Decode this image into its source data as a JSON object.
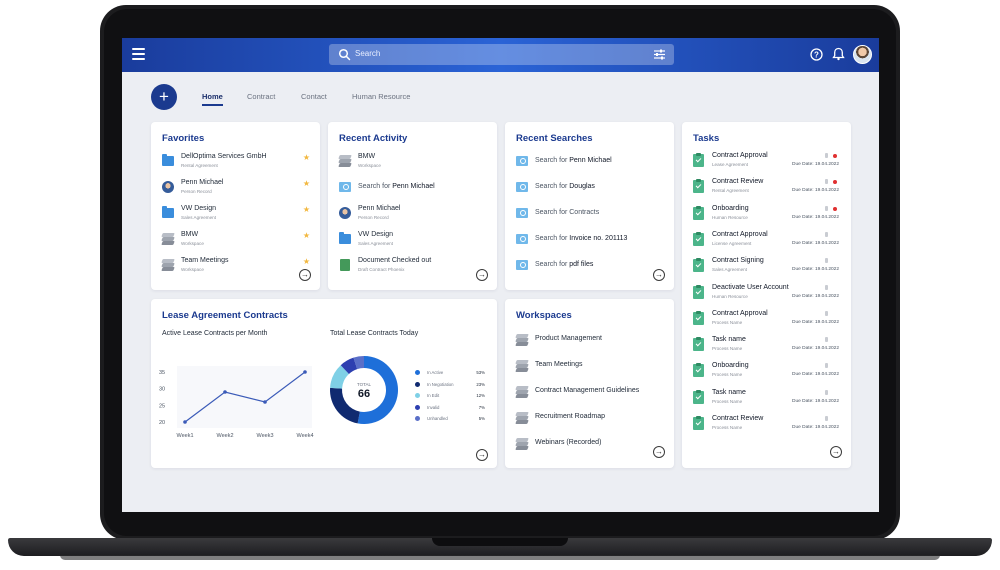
{
  "header": {
    "search_placeholder": "Search",
    "icons": [
      "menu-icon",
      "search-icon",
      "filter-icon",
      "help-icon",
      "bell-icon"
    ]
  },
  "nav": {
    "fab_label": "+",
    "tabs": [
      {
        "label": "Home",
        "active": true
      },
      {
        "label": "Contract",
        "active": false
      },
      {
        "label": "Contact",
        "active": false
      },
      {
        "label": "Human Resource",
        "active": false
      }
    ]
  },
  "favorites": {
    "title": "Favorites",
    "items": [
      {
        "title": "DellOptima Services GmbH",
        "subtitle": "Rental Agreement",
        "icon": "folder-icon"
      },
      {
        "title": "Penn Michael",
        "subtitle": "Person Record",
        "icon": "person-icon"
      },
      {
        "title": "VW Design",
        "subtitle": "Sales Agreement",
        "icon": "folder-icon"
      },
      {
        "title": "BMW",
        "subtitle": "Workspace",
        "icon": "stack-icon"
      },
      {
        "title": "Team Meetings",
        "subtitle": "Workspace",
        "icon": "stack-icon"
      }
    ]
  },
  "recent_activity": {
    "title": "Recent Activity",
    "items": [
      {
        "title": "BMW",
        "subtitle": "Workspace",
        "icon": "stack-icon"
      },
      {
        "prefix": "Search for ",
        "title": "Penn Michael",
        "icon": "search-folder-icon"
      },
      {
        "title": "Penn Michael",
        "subtitle": "Person Record",
        "icon": "person-icon"
      },
      {
        "title": "VW Design",
        "subtitle": "Sales Agreement",
        "icon": "folder-icon"
      },
      {
        "title": "Document Checked out",
        "subtitle": "Draft Contract Phoenix",
        "icon": "doc-icon"
      }
    ]
  },
  "recent_searches": {
    "title": "Recent Searches",
    "items": [
      {
        "prefix": "Search for ",
        "title": "Penn Michael"
      },
      {
        "prefix": "Search for ",
        "title": "Douglas"
      },
      {
        "prefix": "Search for ",
        "title": "Contracts"
      },
      {
        "prefix": "Search for ",
        "title": "Invoice no. 201113"
      },
      {
        "prefix": "Search for ",
        "title": "pdf files"
      }
    ]
  },
  "tasks": {
    "title": "Tasks",
    "items": [
      {
        "title": "Contract Approval",
        "subtitle": "Lease Agreement",
        "due": "Due Date: 19.04.2022",
        "flag": true
      },
      {
        "title": "Contract Review",
        "subtitle": "Rental Agreement",
        "due": "Due Date: 19.04.2022",
        "flag": true
      },
      {
        "title": "Onboarding",
        "subtitle": "Human Resource",
        "due": "Due Date: 19.04.2022",
        "flag": true
      },
      {
        "title": "Contract Approval",
        "subtitle": "License Agreement",
        "due": "Due Date: 19.04.2022",
        "flag": false
      },
      {
        "title": "Contract Signing",
        "subtitle": "Sales Agreement",
        "due": "Due Date: 19.04.2022",
        "flag": false
      },
      {
        "title": "Deactivate User Account",
        "subtitle": "Human Resource",
        "due": "Due Date: 19.04.2022",
        "flag": false
      },
      {
        "title": "Contract Approval",
        "subtitle": "Process Name",
        "due": "Due Date: 19.04.2022",
        "flag": false
      },
      {
        "title": "Task name",
        "subtitle": "Process Name",
        "due": "Due Date: 19.04.2022",
        "flag": false
      },
      {
        "title": "Onboarding",
        "subtitle": "Process Name",
        "due": "Due Date: 19.04.2022",
        "flag": false
      },
      {
        "title": "Task name",
        "subtitle": "Process Name",
        "due": "Due Date: 19.04.2022",
        "flag": false
      },
      {
        "title": "Contract Review",
        "subtitle": "Process Name",
        "due": "Due Date: 19.04.2022",
        "flag": false
      }
    ]
  },
  "lease": {
    "title": "Lease Agreement Contracts",
    "line_heading": "Active Lease Contracts per Month",
    "donut_heading": "Total Lease Contracts Today",
    "donut_center_label": "TOTAL",
    "donut_center_value": "66"
  },
  "workspaces": {
    "title": "Workspaces",
    "items": [
      {
        "title": "Product Management"
      },
      {
        "title": "Team Meetings"
      },
      {
        "title": "Contract Management Guidelines"
      },
      {
        "title": "Recruitment Roadmap"
      },
      {
        "title": "Webinars (Recorded)"
      }
    ]
  },
  "chart_data": [
    {
      "type": "line",
      "title": "Active Lease Contracts per Month",
      "categories": [
        "Week1",
        "Week2",
        "Week3",
        "Week4"
      ],
      "values": [
        20,
        29,
        26,
        35
      ],
      "yticks": [
        "35",
        "30",
        "25",
        "20"
      ],
      "ylim": [
        20,
        35
      ],
      "color": "#3b5bb8"
    },
    {
      "type": "pie",
      "title": "Total Lease Contracts Today",
      "total": 66,
      "slices": [
        {
          "label": "In Active",
          "value": 53,
          "display": "53%",
          "color": "#1e6fd9"
        },
        {
          "label": "In Negotiation",
          "value": 23,
          "display": "23%",
          "color": "#102a70"
        },
        {
          "label": "In Edit",
          "value": 12,
          "display": "12%",
          "color": "#7fd0e6"
        },
        {
          "label": "Invalid",
          "value": 7,
          "display": "7%",
          "color": "#2d3fb0"
        },
        {
          "label": "Unhandled",
          "value": 5,
          "display": "5%",
          "color": "#5a6fc8"
        }
      ]
    }
  ]
}
